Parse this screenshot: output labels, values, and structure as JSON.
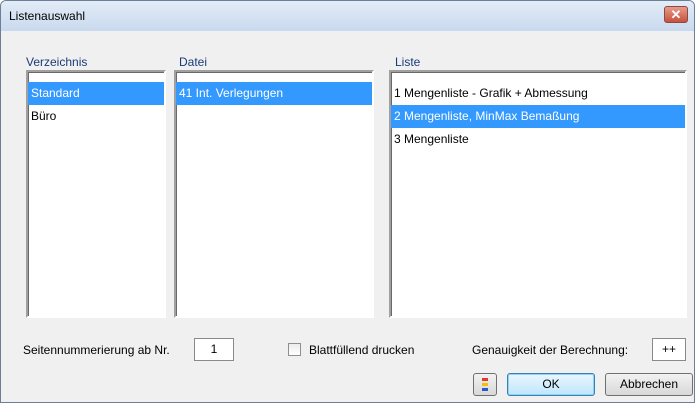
{
  "window": {
    "title": "Listenauswahl",
    "close_symbol": "✕"
  },
  "verzeichnis": {
    "label": "Verzeichnis",
    "items": [
      "Standard",
      "Büro"
    ],
    "selected_index": 0
  },
  "datei": {
    "label": "Datei",
    "items": [
      "41 Int. Verlegungen"
    ],
    "selected_index": 0
  },
  "liste": {
    "label": "Liste",
    "items": [
      "1 Mengenliste - Grafik + Abmessung",
      "2 Mengenliste, MinMax Bemaßung",
      "3 Mengenliste"
    ],
    "selected_index": 1
  },
  "footer": {
    "page_numbering_label": "Seitennummerierung ab Nr.",
    "page_numbering_value": "1",
    "fullpage_label": "Blattfüllend drucken",
    "fullpage_checked": false,
    "precision_label": "Genauigkeit der Berechnung:",
    "precision_value": "++"
  },
  "buttons": {
    "ok": "OK",
    "cancel": "Abbrechen"
  },
  "colors": {
    "selection": "#3399ff",
    "section_label": "#1a3a7a"
  }
}
